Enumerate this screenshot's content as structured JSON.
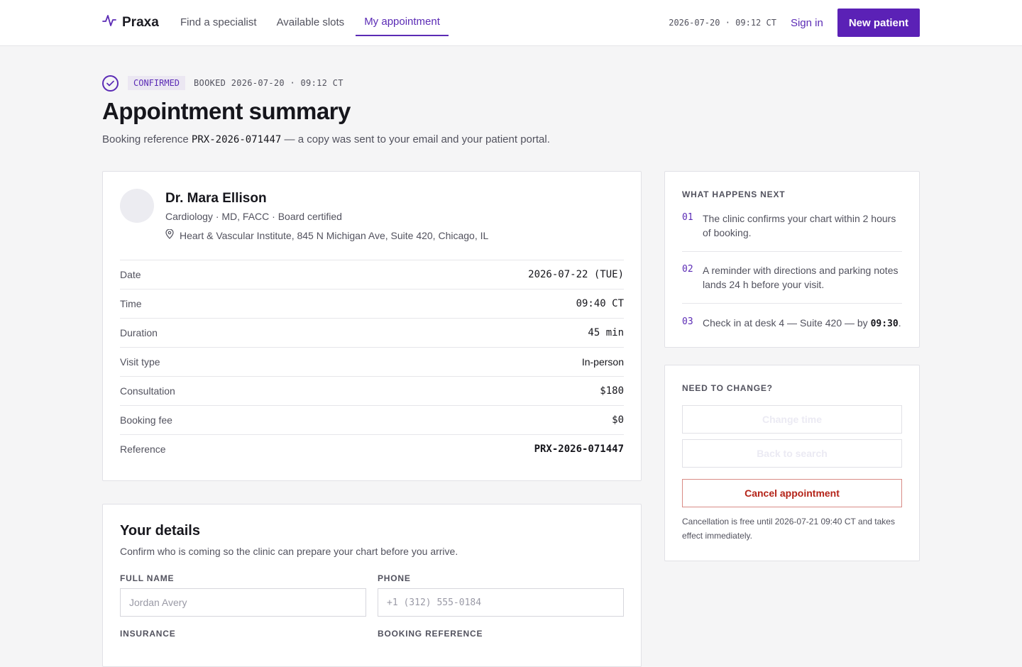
{
  "nav": {
    "brand": "Praxa",
    "items": [
      {
        "label": "Find a specialist",
        "active": false
      },
      {
        "label": "Available slots",
        "active": false
      },
      {
        "label": "My appointment",
        "active": true
      }
    ],
    "clock": "2026-07-20 · 09:12 CT",
    "sign_in": "Sign in",
    "new_patient": "New patient"
  },
  "header": {
    "status_badge": "CONFIRMED",
    "booked": "BOOKED 2026-07-20 · 09:12 CT",
    "title": "Appointment summary",
    "sub_prefix": "Booking reference",
    "sub_ref": "PRX-2026-071447",
    "sub_suffix": "— a copy was sent to your email and your patient portal."
  },
  "doctor": {
    "name": "Dr. Mara Ellison",
    "meta": "Cardiology · MD, FACC · Board certified",
    "address": "Heart & Vascular Institute, 845 N Michigan Ave, Suite 420, Chicago, IL"
  },
  "summary_rows": [
    {
      "label": "Date",
      "value": "2026-07-22 (TUE)"
    },
    {
      "label": "Time",
      "value": "09:40 CT"
    },
    {
      "label": "Duration",
      "value": "45 min"
    },
    {
      "label": "Visit type",
      "value": "In-person"
    },
    {
      "label": "Consultation",
      "value": "$180"
    },
    {
      "label": "Booking fee",
      "value": "$0"
    },
    {
      "label": "Reference",
      "value": "PRX-2026-071447"
    }
  ],
  "details": {
    "title": "Your details",
    "subtitle": "Confirm who is coming so the clinic can prepare your chart before you arrive.",
    "full_name_label": "FULL NAME",
    "full_name_placeholder": "Jordan Avery",
    "phone_label": "PHONE",
    "phone_placeholder": "+1 (312) 555-0184",
    "insurance_label": "INSURANCE",
    "booking_ref_label": "BOOKING REFERENCE"
  },
  "next": {
    "title": "WHAT HAPPENS NEXT",
    "steps": [
      {
        "num": "01",
        "text": "The clinic confirms your chart within 2 hours of booking."
      },
      {
        "num": "02",
        "text": "A reminder with directions and parking notes lands 24 h before your visit."
      },
      {
        "num": "03",
        "text_prefix": "Check in at desk 4 — Suite 420 — by",
        "time": "09:30",
        "text_suffix": "."
      }
    ]
  },
  "change": {
    "title": "NEED TO CHANGE?",
    "change_time": "Change time",
    "back_to_search": "Back to search",
    "cancel": "Cancel appointment",
    "note": "Cancellation is free until 2026-07-21 09:40 CT and takes effect immediately."
  },
  "colors": {
    "accent": "#5b21b6",
    "danger": "#b42318"
  }
}
